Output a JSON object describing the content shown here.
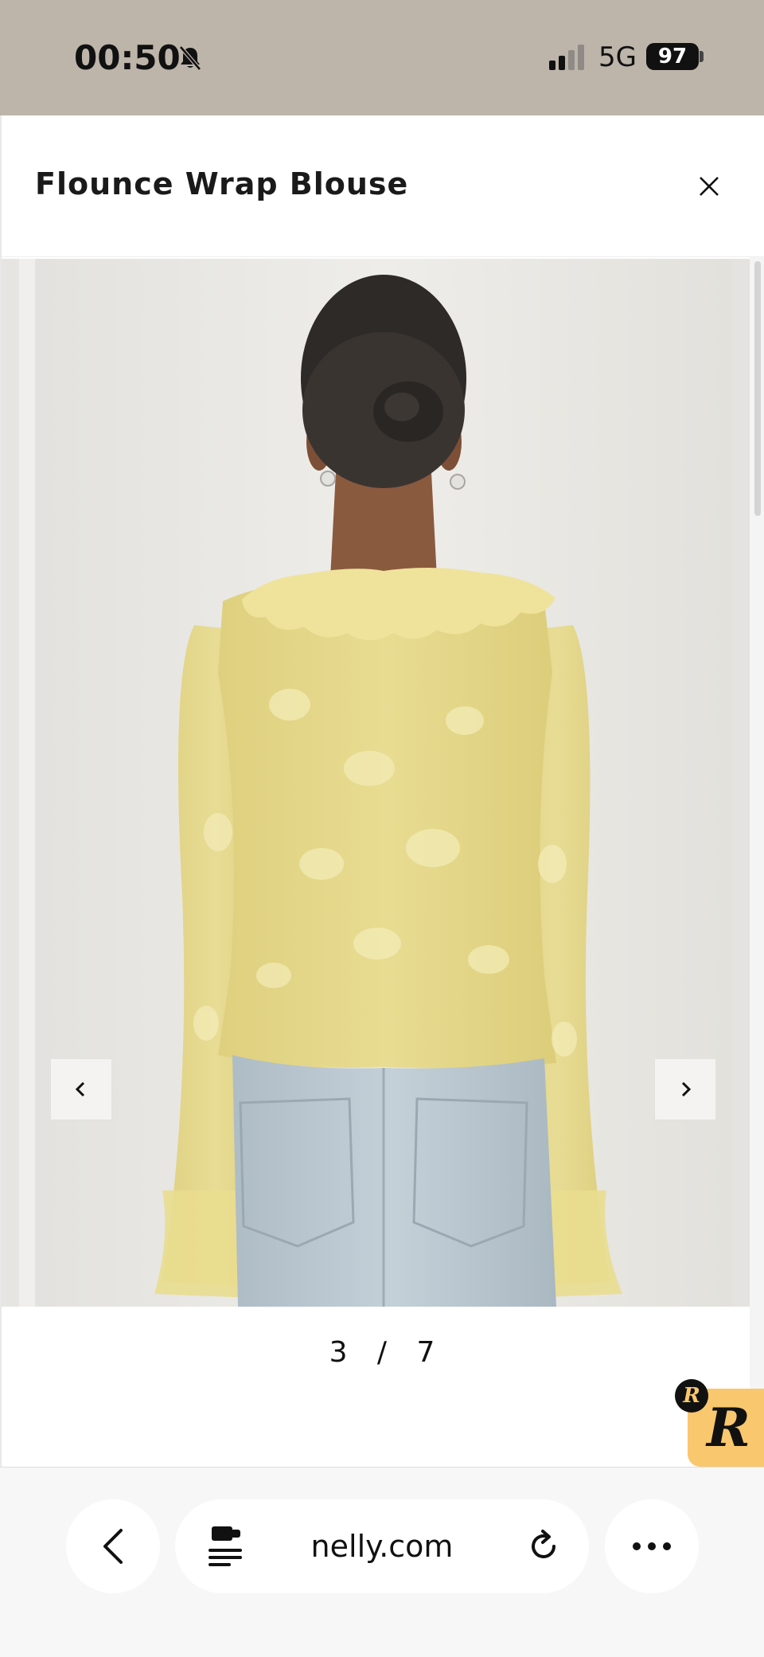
{
  "status_bar": {
    "time": "00:50",
    "network": "5G",
    "battery": "97",
    "icons": [
      "bell-slash-icon",
      "signal-icon"
    ]
  },
  "modal": {
    "title": "Flounce Wrap Blouse",
    "close_icon": "close-icon"
  },
  "gallery": {
    "current": "3",
    "separator": "/",
    "total": "7",
    "prev_icon": "chevron-left-icon",
    "next_icon": "chevron-right-icon"
  },
  "widget": {
    "letter": "R",
    "badge_letter": "R",
    "color": "#f9c76d"
  },
  "browser": {
    "url": "nelly.com",
    "back_icon": "chevron-left-icon",
    "page_icon": "page-settings-icon",
    "reload_icon": "reload-icon",
    "more_icon": "more-icon"
  },
  "colors": {
    "status_bar_bg": "#bdb4aa",
    "blouse": "#e6d98a",
    "jeans": "#b9c6cf"
  }
}
